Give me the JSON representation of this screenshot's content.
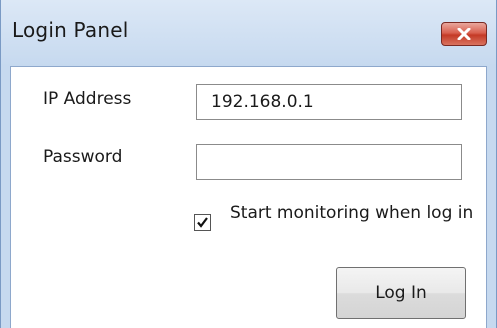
{
  "window": {
    "title": "Login Panel"
  },
  "form": {
    "ip_label": "IP Address",
    "ip_value": "192.168.0.1",
    "password_label": "Password",
    "password_value": "",
    "monitor_checkbox": {
      "checked": true,
      "label": "Start monitoring when log in"
    },
    "login_button_label": "Log In"
  },
  "icons": {
    "close": "close-icon",
    "check": "checkmark-icon"
  },
  "colors": {
    "title_bar": "#c6d9ef",
    "close_button": "#d9604f",
    "client_background": "#ffffff"
  }
}
